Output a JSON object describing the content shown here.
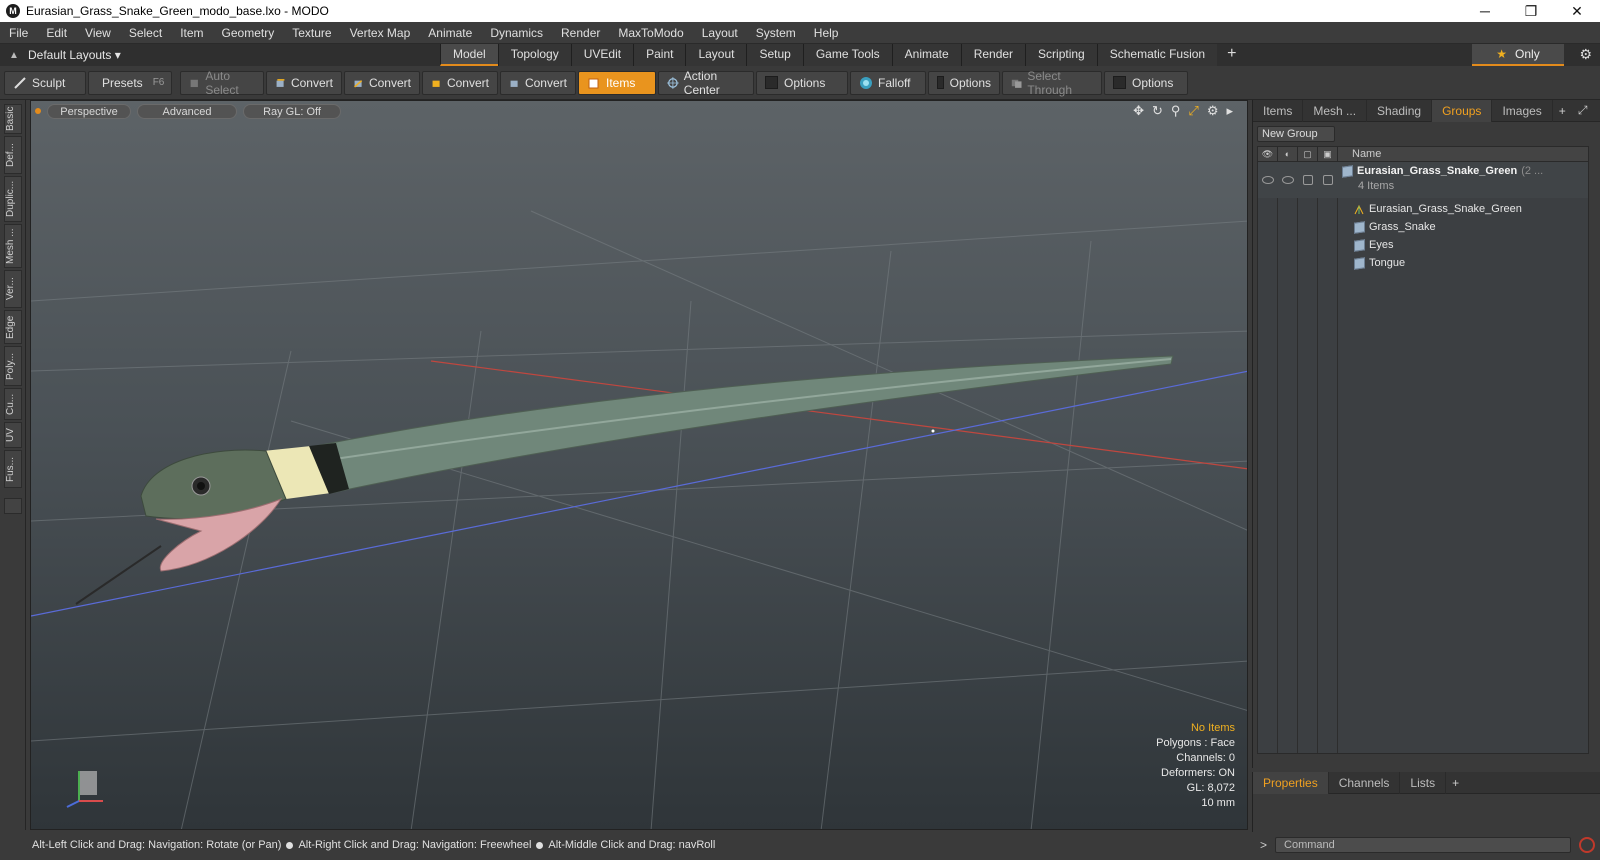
{
  "window": {
    "title": "Eurasian_Grass_Snake_Green_modo_base.lxo - MODO",
    "minimize": "─",
    "restore": "❐",
    "close": "✕"
  },
  "menu": [
    "File",
    "Edit",
    "View",
    "Select",
    "Item",
    "Geometry",
    "Texture",
    "Vertex Map",
    "Animate",
    "Dynamics",
    "Render",
    "MaxToModo",
    "Layout",
    "System",
    "Help"
  ],
  "layout_bar": {
    "default_layouts": "Default Layouts ▾",
    "tabs": [
      "Model",
      "Topology",
      "UVEdit",
      "Paint",
      "Layout",
      "Setup",
      "Game Tools",
      "Animate",
      "Render",
      "Scripting",
      "Schematic Fusion"
    ],
    "active_tab": "Model",
    "plus": "+",
    "only_label": "Only",
    "only_star": "★"
  },
  "toolbar": {
    "sculpt": "Sculpt",
    "presets": "Presets",
    "presets_key": "F6",
    "auto_select": "Auto Select",
    "convert1": "Convert",
    "convert2": "Convert",
    "convert3": "Convert",
    "convert4": "Convert",
    "items": "Items",
    "action_center": "Action Center",
    "options1": "Options",
    "falloff": "Falloff",
    "options2": "Options",
    "select_through": "Select Through",
    "options3": "Options"
  },
  "left_tabs": [
    "Basic",
    "Def...",
    "Duplic...",
    "Mesh ...",
    "Ver...",
    "Edge",
    "Poly...",
    "Cu...",
    "UV",
    "Fus..."
  ],
  "viewport": {
    "perspective": "Perspective",
    "advanced": "Advanced",
    "raygl": "Ray GL: Off",
    "info": {
      "no_items": "No Items",
      "polygons": "Polygons : Face",
      "channels": "Channels: 0",
      "deformers": "Deformers: ON",
      "gl": "GL: 8,072",
      "scale": "10 mm"
    }
  },
  "status": {
    "hint1": "Alt-Left Click and Drag: Navigation: Rotate (or Pan)",
    "hint2": "Alt-Right Click and Drag: Navigation: Freewheel",
    "hint3": "Alt-Middle Click and Drag: navRoll"
  },
  "right_panel": {
    "tabs": [
      "Items",
      "Mesh ...",
      "Shading",
      "Groups",
      "Images"
    ],
    "active_tab": "Groups",
    "new_group": "New Group",
    "name_header": "Name",
    "group": {
      "name": "Eurasian_Grass_Snake_Green",
      "suffix": "(2 ...",
      "count": "4 Items",
      "children": [
        "Eurasian_Grass_Snake_Green",
        "Grass_Snake",
        "Eyes",
        "Tongue"
      ]
    }
  },
  "bottom_panel": {
    "tabs": [
      "Properties",
      "Channels",
      "Lists"
    ],
    "active_tab": "Properties",
    "plus": "+"
  },
  "command": {
    "placeholder": "Command",
    "prompt": ">"
  },
  "colors": {
    "accent": "#e9941e",
    "snake_body": "#6f8672",
    "snake_collar": "#e9e4b4",
    "mouth": "#d9a4a8"
  }
}
